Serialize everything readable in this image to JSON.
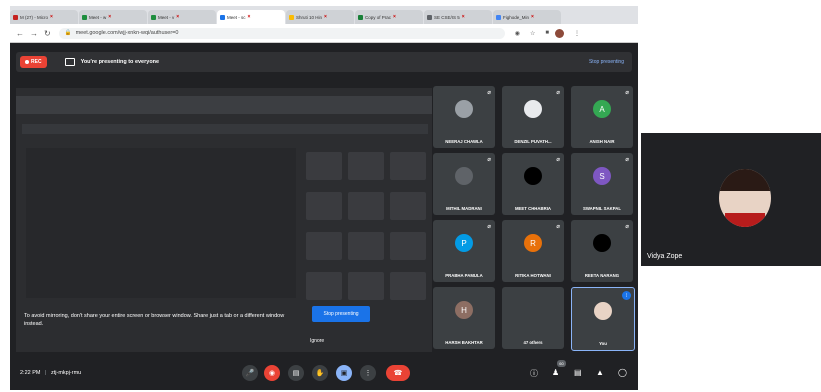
{
  "browser": {
    "tabs": [
      {
        "label": "M (27) - Micro",
        "color": "#c5221f"
      },
      {
        "label": "Meet - w",
        "color": "#1e8e3e"
      },
      {
        "label": "Meet - v",
        "color": "#1e8e3e"
      },
      {
        "label": "Meet - sc",
        "color": "#1a73e8",
        "active": true
      },
      {
        "label": "Shruti 10 Hin",
        "color": "#fbbc04"
      },
      {
        "label": "Copy of Prac",
        "color": "#188038"
      },
      {
        "label": "SE CSE/IS 5",
        "color": "#5f6368"
      },
      {
        "label": "Fighode_Min",
        "color": "#4285f4"
      }
    ],
    "url": "meet.google.com/wjj-xnkn-wqi/authuser=0"
  },
  "presenting": {
    "rec_label": "REC",
    "message": "You're presenting to everyone",
    "stop_link": "Stop presenting"
  },
  "shared_screen": {
    "warning": "To avoid mirroring, don't share your entire screen or browser window. Share just a tab or a different window instead.",
    "stop_button": "Stop presenting",
    "ignore": "Ignore"
  },
  "participants": [
    {
      "name": "NEERAJ CHAWLA",
      "initial": "",
      "avatar_color": "#9aa0a6"
    },
    {
      "name": "DENZIL PUVATH...",
      "initial": "",
      "avatar_color": "#e8eaed"
    },
    {
      "name": "ANISH NAIR",
      "initial": "A",
      "avatar_color": "#34a853"
    },
    {
      "name": "MITHIL MADRANI",
      "initial": "",
      "avatar_color": "#5f6368"
    },
    {
      "name": "MEET CHHABRIA",
      "initial": "",
      "avatar_color": "#000000"
    },
    {
      "name": "SWAPNIL SAKPAL",
      "initial": "S",
      "avatar_color": "#7e57c2"
    },
    {
      "name": "PRABHA PAMULA",
      "initial": "P",
      "avatar_color": "#039be5"
    },
    {
      "name": "RITIKA HOTWANI",
      "initial": "R",
      "avatar_color": "#e8710a"
    },
    {
      "name": "REETA NARANG",
      "initial": "",
      "avatar_color": "#000000"
    },
    {
      "name": "HARSH BAKHTAR",
      "initial": "H",
      "avatar_color": "#8d6e63"
    },
    {
      "name": "47 others",
      "initial": "",
      "avatar_color": "#3c4043"
    },
    {
      "name": "You",
      "initial": "",
      "avatar_color": "#e8d3c5"
    }
  ],
  "bottom": {
    "time": "2:22 PM",
    "meeting_code": "ztj-mkpj-rmu",
    "people_count": "60"
  },
  "side_video": {
    "name": "Vidya Zope"
  }
}
